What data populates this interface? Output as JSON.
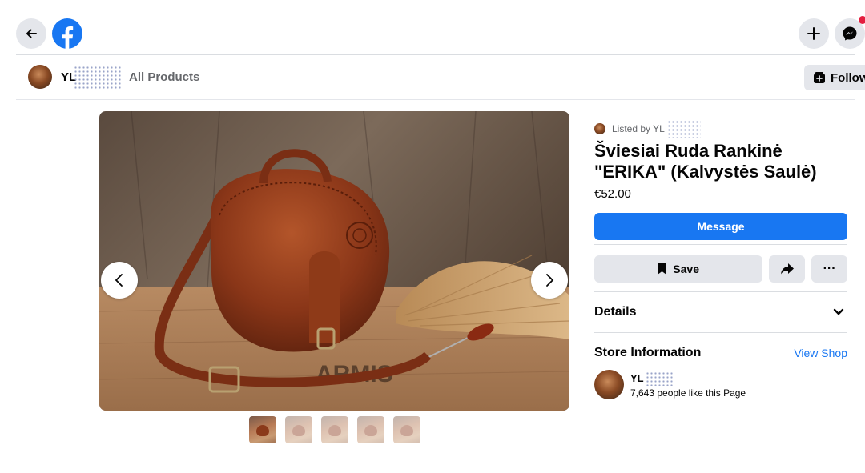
{
  "header": {
    "back_icon": "arrow-left-icon",
    "logo_icon": "facebook-logo-icon",
    "create_icon": "plus-icon",
    "messenger_icon": "messenger-icon",
    "colors": {
      "brand": "#1877f2",
      "button_bg": "#e4e6eb",
      "notif": "#e41e3f"
    }
  },
  "page_bar": {
    "page_name": "YL",
    "nav_link": "All Products",
    "follow_label": "Follow"
  },
  "product": {
    "listed_by": "Listed by YL",
    "title": "Šviesiai Ruda Rankinė \"ERIKA\" (Kalvystės Saulė)",
    "price": "€52.00",
    "message_label": "Message",
    "save_label": "Save",
    "more_label": "···",
    "details_label": "Details",
    "image_text": "ARMIS",
    "thumbnail_count": 5,
    "selected_thumbnail": 1
  },
  "store": {
    "section_title": "Store Information",
    "view_shop_label": "View Shop",
    "name": "YL",
    "likes": "7,643 people like this Page"
  }
}
